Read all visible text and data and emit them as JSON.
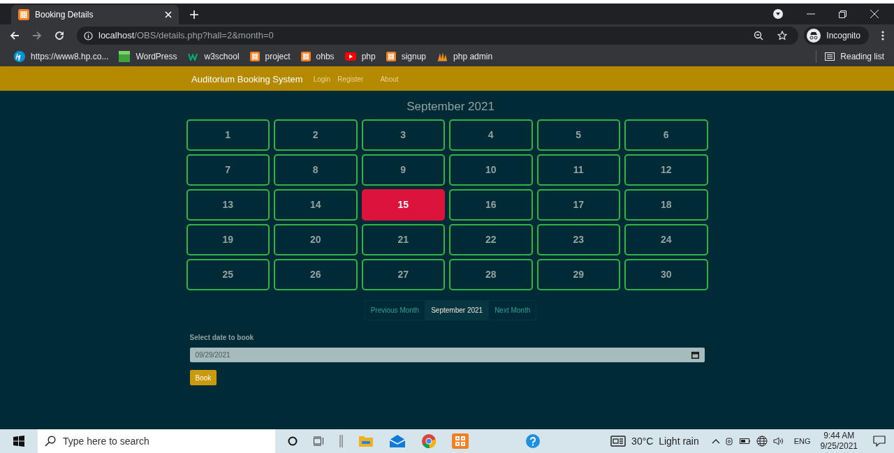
{
  "browser": {
    "tab_title": "Booking Details",
    "url_host": "localhost",
    "url_path": "/OBS/details.php?hall=2&month=0",
    "profile": "Incognito",
    "bookmarks": [
      {
        "kind": "hp",
        "label": "https://www8.hp.co..."
      },
      {
        "kind": "wordpress",
        "label": "WordPress"
      },
      {
        "kind": "w3",
        "label": "w3school"
      },
      {
        "kind": "xampp",
        "label": "project"
      },
      {
        "kind": "xampp",
        "label": "ohbs"
      },
      {
        "kind": "youtube",
        "label": "php"
      },
      {
        "kind": "xampp",
        "label": "signup"
      },
      {
        "kind": "pma",
        "label": "php admin"
      }
    ],
    "reading_list": "Reading list"
  },
  "navbar": {
    "brand": "Auditorium Booking System",
    "links": [
      "Login",
      "Register",
      "About"
    ]
  },
  "calendar": {
    "title": "September 2021",
    "days": [
      {
        "label": "1",
        "selected": false
      },
      {
        "label": "2",
        "selected": false
      },
      {
        "label": "3",
        "selected": false
      },
      {
        "label": "4",
        "selected": false
      },
      {
        "label": "5",
        "selected": false
      },
      {
        "label": "6",
        "selected": false
      },
      {
        "label": "7",
        "selected": false
      },
      {
        "label": "8",
        "selected": false
      },
      {
        "label": "9",
        "selected": false
      },
      {
        "label": "10",
        "selected": false
      },
      {
        "label": "11",
        "selected": false
      },
      {
        "label": "12",
        "selected": false
      },
      {
        "label": "13",
        "selected": false
      },
      {
        "label": "14",
        "selected": false
      },
      {
        "label": "15",
        "selected": true
      },
      {
        "label": "16",
        "selected": false
      },
      {
        "label": "17",
        "selected": false
      },
      {
        "label": "18",
        "selected": false
      },
      {
        "label": "19",
        "selected": false
      },
      {
        "label": "20",
        "selected": false
      },
      {
        "label": "21",
        "selected": false
      },
      {
        "label": "22",
        "selected": false
      },
      {
        "label": "23",
        "selected": false
      },
      {
        "label": "24",
        "selected": false
      },
      {
        "label": "25",
        "selected": false
      },
      {
        "label": "26",
        "selected": false
      },
      {
        "label": "27",
        "selected": false
      },
      {
        "label": "28",
        "selected": false
      },
      {
        "label": "29",
        "selected": false
      },
      {
        "label": "30",
        "selected": false
      }
    ],
    "pager": [
      {
        "label": "Previous Month",
        "selected": false
      },
      {
        "label": "September 2021",
        "selected": true
      },
      {
        "label": "Next Month",
        "selected": false
      }
    ]
  },
  "booking_form": {
    "label": "Select date to book",
    "date_value": "09/29/2021",
    "button": "Book"
  },
  "taskbar": {
    "search_placeholder": "Type here to search",
    "weather": "30°C  Light rain",
    "language": "ENG",
    "time": "9:44 AM",
    "date": "9/25/2021"
  }
}
